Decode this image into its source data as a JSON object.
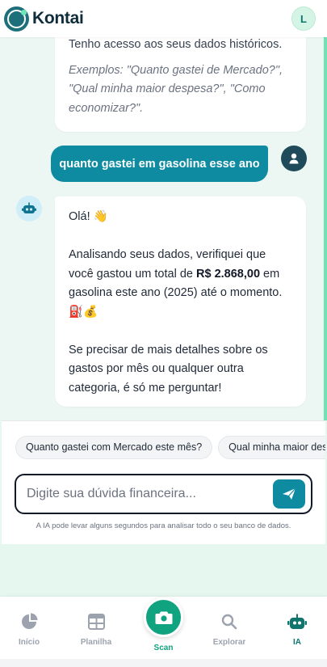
{
  "header": {
    "brand": "Kontai",
    "avatar_initial": "L"
  },
  "messages": {
    "bot_intro": {
      "line1": "Tenho acesso aos seus dados históricos.",
      "examples": "Exemplos: \"Quanto gastei de Mercado?\", \"Qual minha maior despesa?\", \"Como economizar?\"."
    },
    "user_question": "quanto gastei em gasolina esse ano",
    "bot_reply": {
      "greeting": "Olá! 👋",
      "analysis_prefix": "Analisando seus dados, verifiquei que você gastou um total de ",
      "amount": "R$ 2.868,00",
      "analysis_suffix": " em gasolina este ano (2025) até o momento.",
      "emojis": "⛽💰",
      "closing": "Se precisar de mais detalhes sobre os gastos por mês ou qualquer outra categoria, é só me perguntar!"
    }
  },
  "suggestions": [
    "Quanto gastei com Mercado este mês?",
    "Qual minha maior despesa?"
  ],
  "input": {
    "placeholder": "Digite sua dúvida financeira..."
  },
  "disclaimer": "A IA pode levar alguns segundos para analisar todo o seu banco de dados.",
  "nav": {
    "items": [
      {
        "label": "Início",
        "icon": "pie-chart-icon"
      },
      {
        "label": "Planilha",
        "icon": "table-icon"
      },
      {
        "label": "Scan",
        "icon": "camera-icon"
      },
      {
        "label": "Explorar",
        "icon": "search-icon"
      },
      {
        "label": "IA",
        "icon": "robot-icon"
      }
    ],
    "active": "IA"
  },
  "colors": {
    "accent": "#0e8aa1",
    "brand_green": "#10a37f",
    "background": "#e6f7f0"
  }
}
